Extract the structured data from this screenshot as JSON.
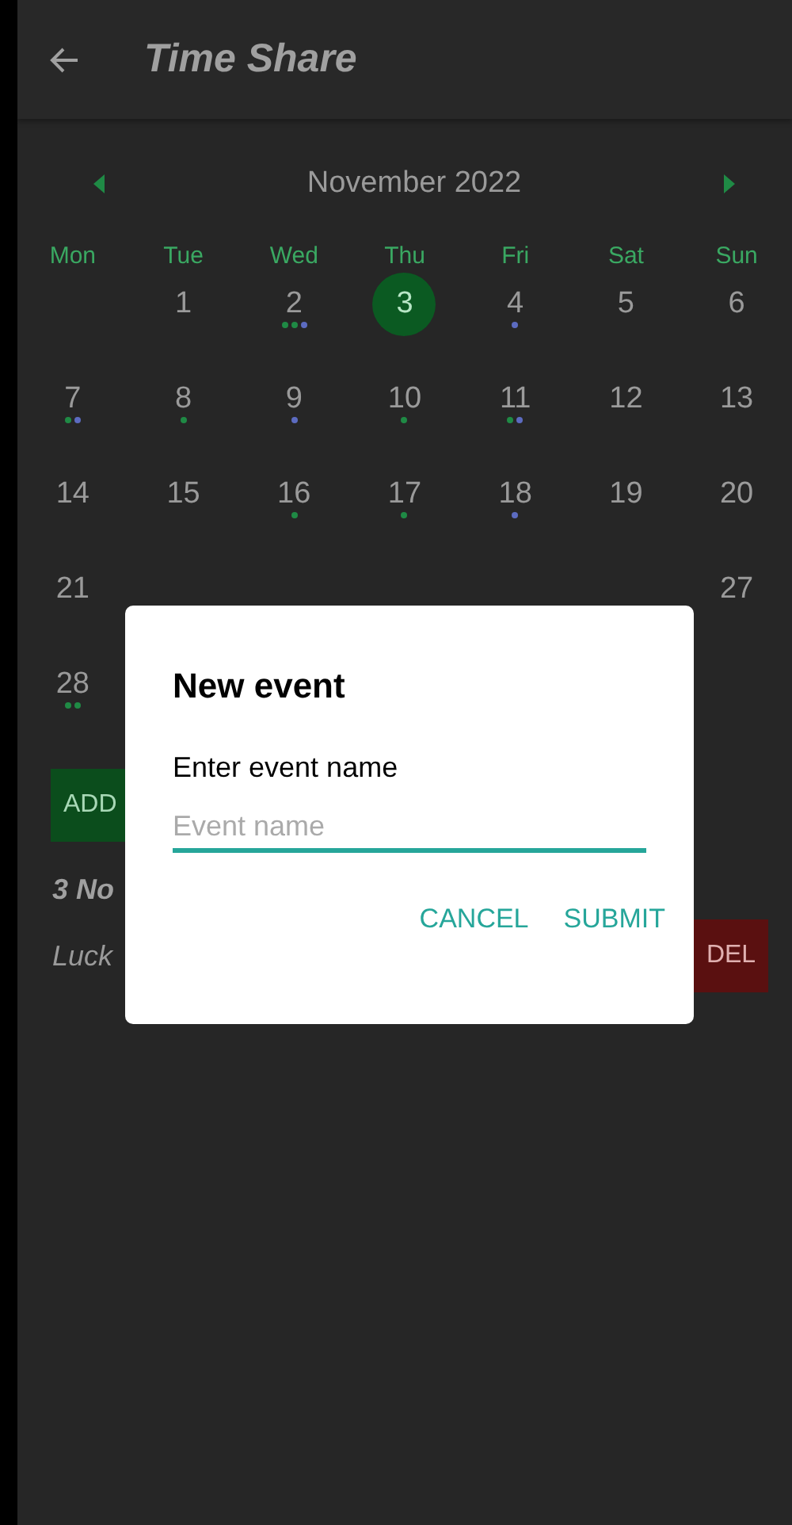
{
  "app_bar": {
    "title": "Time Share"
  },
  "calendar": {
    "month": "November 2022",
    "weekdays": [
      "Mon",
      "Tue",
      "Wed",
      "Thu",
      "Fri",
      "Sat",
      "Sun"
    ],
    "weeks": [
      [
        {
          "kind": "blank"
        },
        {
          "kind": "day",
          "day": "1",
          "selected": false
        },
        {
          "kind": "day",
          "day": "2",
          "selected": false,
          "dots": [
            {
              "color": "#1f8a45"
            },
            {
              "color": "#1f8a45"
            },
            {
              "color": "#5c6bc0"
            }
          ]
        },
        {
          "kind": "day",
          "day": "3",
          "selected": true
        },
        {
          "kind": "day",
          "day": "4",
          "selected": false,
          "dots": [
            {
              "color": "#5c6bc0"
            }
          ]
        },
        {
          "kind": "day",
          "day": "5",
          "selected": false
        },
        {
          "kind": "day",
          "day": "6",
          "selected": false
        }
      ],
      [
        {
          "kind": "day",
          "day": "7",
          "selected": false,
          "dots": [
            {
              "color": "#1f8a45"
            },
            {
              "color": "#5c6bc0"
            }
          ]
        },
        {
          "kind": "day",
          "day": "8",
          "selected": false,
          "dots": [
            {
              "color": "#1f8a45"
            }
          ]
        },
        {
          "kind": "day",
          "day": "9",
          "selected": false,
          "dots": [
            {
              "color": "#5c6bc0"
            }
          ]
        },
        {
          "kind": "day",
          "day": "10",
          "selected": false,
          "dots": [
            {
              "color": "#1f8a45"
            }
          ]
        },
        {
          "kind": "day",
          "day": "11",
          "selected": false,
          "dots": [
            {
              "color": "#1f8a45"
            },
            {
              "color": "#5c6bc0"
            }
          ]
        },
        {
          "kind": "day",
          "day": "12",
          "selected": false
        },
        {
          "kind": "day",
          "day": "13",
          "selected": false
        }
      ],
      [
        {
          "kind": "day",
          "day": "14",
          "selected": false
        },
        {
          "kind": "day",
          "day": "15",
          "selected": false
        },
        {
          "kind": "day",
          "day": "16",
          "selected": false,
          "dots": [
            {
              "color": "#1f8a45"
            }
          ]
        },
        {
          "kind": "day",
          "day": "17",
          "selected": false,
          "dots": [
            {
              "color": "#1f8a45"
            }
          ]
        },
        {
          "kind": "day",
          "day": "18",
          "selected": false,
          "dots": [
            {
              "color": "#5c6bc0"
            }
          ]
        },
        {
          "kind": "day",
          "day": "19",
          "selected": false
        },
        {
          "kind": "day",
          "day": "20",
          "selected": false
        }
      ],
      [
        {
          "kind": "day",
          "day": "21",
          "selected": false
        },
        {
          "kind": "blank"
        },
        {
          "kind": "blank"
        },
        {
          "kind": "blank"
        },
        {
          "kind": "blank"
        },
        {
          "kind": "blank"
        },
        {
          "kind": "day",
          "day": "27",
          "selected": false
        }
      ],
      [
        {
          "kind": "day",
          "day": "28",
          "selected": false,
          "dots": [
            {
              "color": "#1f8a45"
            },
            {
              "color": "#1f8a45"
            }
          ]
        }
      ]
    ]
  },
  "add_button": {
    "label": "ADD"
  },
  "events_heading": "3 No",
  "event_row": {
    "text": "Luck",
    "delete_label": "DEL"
  },
  "dialog": {
    "title": "New event",
    "prompt": "Enter event name",
    "placeholder": "Event name",
    "buttons": [
      "CANCEL",
      "SUBMIT"
    ]
  }
}
